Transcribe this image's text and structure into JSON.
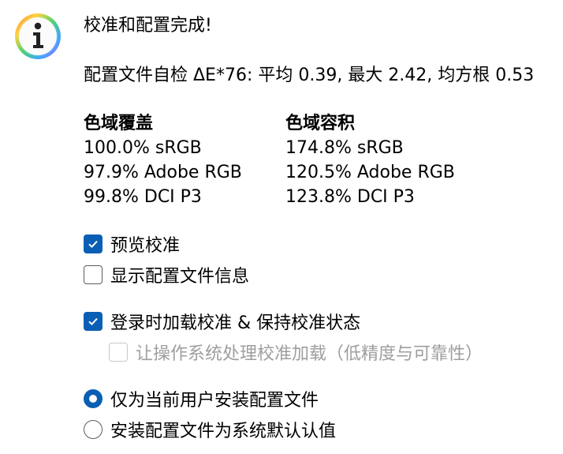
{
  "dialog": {
    "title": "校准和配置完成!",
    "self_check": "配置文件自检 ΔE*76: 平均 0.39, 最大 2.42, 均方根 0.53"
  },
  "gamut_coverage": {
    "heading": "色域覆盖",
    "rows": [
      "100.0% sRGB",
      "97.9% Adobe RGB",
      "99.8% DCI P3"
    ]
  },
  "gamut_volume": {
    "heading": "色域容积",
    "rows": [
      "174.8% sRGB",
      "120.5% Adobe RGB",
      "123.8% DCI P3"
    ]
  },
  "options": {
    "preview_calibration": {
      "label": "预览校准",
      "checked": true
    },
    "show_profile_info": {
      "label": "显示配置文件信息",
      "checked": false
    },
    "load_on_login": {
      "label": "登录时加载校准 & 保持校准状态",
      "checked": true
    },
    "let_os_handle": {
      "label": "让操作系统处理校准加载（低精度与可靠性）",
      "checked": false,
      "enabled": false
    }
  },
  "install_scope": {
    "current_user": {
      "label": "仅为当前用户安装配置文件",
      "selected": true
    },
    "system_default": {
      "label": "安装配置文件为系统默认认值",
      "selected": false
    }
  },
  "colors": {
    "accent": "#0a5fb4",
    "disabled_text": "#9e9e9e"
  },
  "icons": {
    "info": "info-icon",
    "check": "check-icon"
  }
}
